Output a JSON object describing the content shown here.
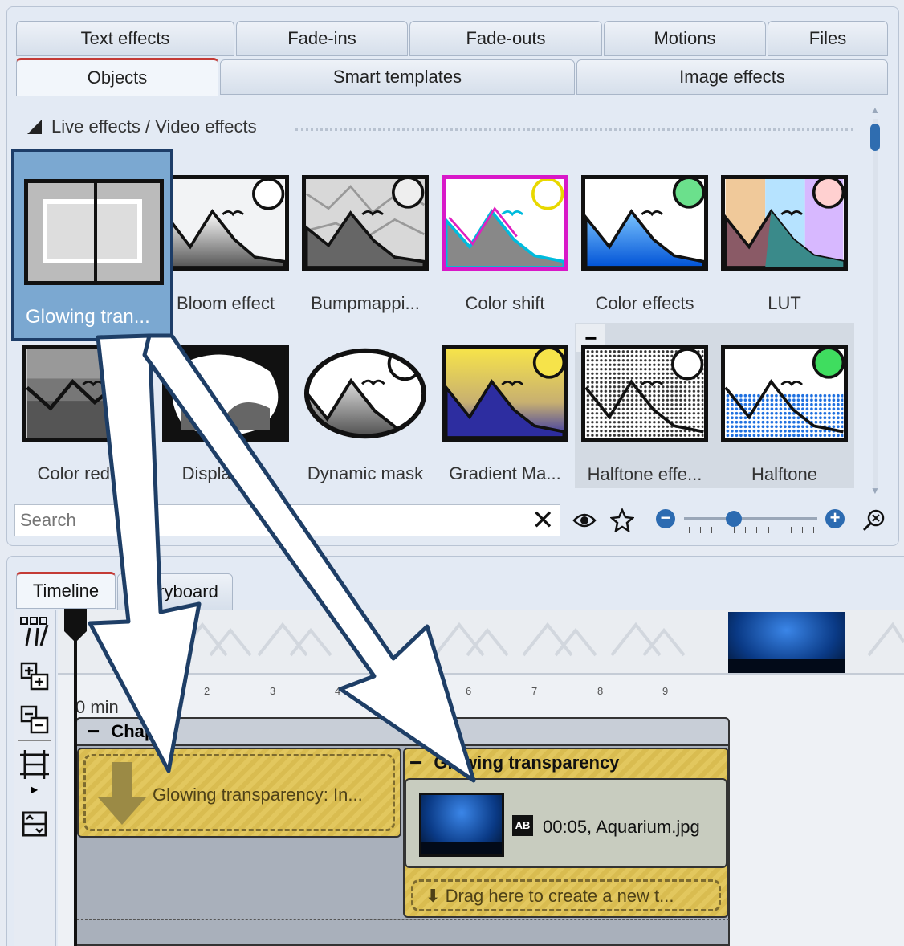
{
  "effects_tabs_row1": [
    "Text effects",
    "Fade-ins",
    "Fade-outs",
    "Motions",
    "Files"
  ],
  "effects_tabs_row2": [
    "Objects",
    "Smart templates",
    "Image effects"
  ],
  "section_title": "Live effects / Video effects",
  "effects": [
    {
      "label": "Glowing tran..."
    },
    {
      "label": "Bloom effect"
    },
    {
      "label": "Bumpmappi..."
    },
    {
      "label": "Color shift"
    },
    {
      "label": "Color effects"
    },
    {
      "label": "LUT"
    },
    {
      "label": "Color redu..."
    },
    {
      "label": "Displacer..."
    },
    {
      "label": "Dynamic mask"
    },
    {
      "label": "Gradient Ma..."
    },
    {
      "label": "Halftone effe..."
    },
    {
      "label": "Halftone"
    }
  ],
  "search": {
    "placeholder": "Search"
  },
  "timeline_tabs": [
    "Timeline",
    "Storyboard"
  ],
  "ruler": {
    "start": "0 min",
    "ticks": [
      "2",
      "3",
      "4",
      "6",
      "7",
      "8",
      "9"
    ]
  },
  "chapter": {
    "title": "Chapter"
  },
  "drop_slot": {
    "label": "Glowing transparency: In..."
  },
  "effect_object": {
    "title": "Glowing transparency"
  },
  "clip": {
    "duration": "00:05,",
    "filename": "Aquarium.jpg"
  },
  "drag_hint": "Drag here to create a new t...",
  "colors": {
    "accent": "#2c6bb1",
    "active_tab": "#c43b36",
    "object_yellow": "#e2c75e",
    "drag_arrow_border": "#1e3e66"
  }
}
